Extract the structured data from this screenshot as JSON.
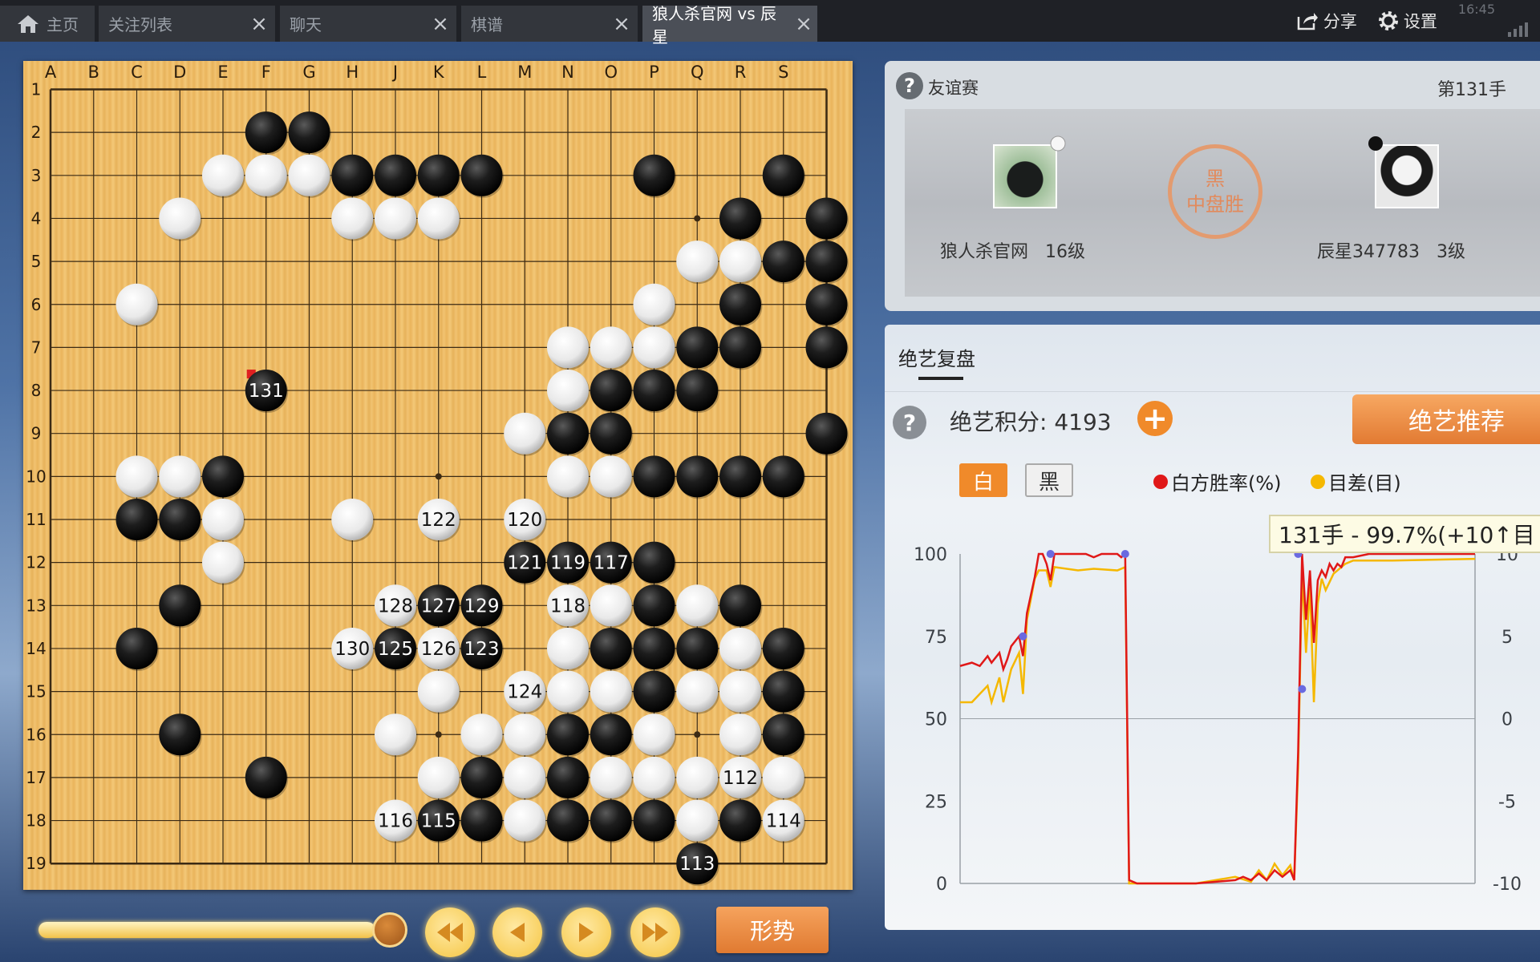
{
  "tabs": [
    {
      "label": "主页",
      "closable": false
    },
    {
      "label": "关注列表",
      "closable": true
    },
    {
      "label": "聊天",
      "closable": true
    },
    {
      "label": "棋谱",
      "closable": true
    },
    {
      "label": "狼人杀官网 vs 辰星",
      "closable": true,
      "active": true
    }
  ],
  "topbar": {
    "share": "分享",
    "settings": "设置",
    "status_time": "16:45"
  },
  "board": {
    "cols": [
      "A",
      "B",
      "C",
      "D",
      "E",
      "F",
      "G",
      "H",
      "J",
      "K",
      "L",
      "M",
      "N",
      "O",
      "P",
      "Q",
      "R",
      "S"
    ],
    "rows": [
      "1",
      "2",
      "3",
      "4",
      "5",
      "6",
      "7",
      "8",
      "9",
      "10",
      "11",
      "12",
      "13",
      "14",
      "15",
      "16",
      "17",
      "18",
      "19"
    ],
    "last_move": "131",
    "stones": [
      {
        "c": "F2",
        "k": "b"
      },
      {
        "c": "G2",
        "k": "b"
      },
      {
        "c": "E3",
        "k": "w"
      },
      {
        "c": "F3",
        "k": "w"
      },
      {
        "c": "G3",
        "k": "w"
      },
      {
        "c": "H3",
        "k": "b"
      },
      {
        "c": "I3",
        "k": "b"
      },
      {
        "c": "J3",
        "k": "b"
      },
      {
        "c": "K3",
        "k": "b"
      },
      {
        "c": "O3",
        "k": "b"
      },
      {
        "c": "R3",
        "k": "b"
      },
      {
        "c": "D4",
        "k": "w"
      },
      {
        "c": "H4",
        "k": "w"
      },
      {
        "c": "I4",
        "k": "w"
      },
      {
        "c": "J4",
        "k": "w"
      },
      {
        "c": "Q4",
        "k": "b"
      },
      {
        "c": "S4",
        "k": "b"
      },
      {
        "c": "P5",
        "k": "w"
      },
      {
        "c": "Q5",
        "k": "w"
      },
      {
        "c": "R5",
        "k": "b"
      },
      {
        "c": "S5",
        "k": "b"
      },
      {
        "c": "C6",
        "k": "w"
      },
      {
        "c": "O6",
        "k": "w"
      },
      {
        "c": "Q6",
        "k": "b"
      },
      {
        "c": "S6",
        "k": "b"
      },
      {
        "c": "M7",
        "k": "w"
      },
      {
        "c": "N7",
        "k": "w"
      },
      {
        "c": "O7",
        "k": "w"
      },
      {
        "c": "P7",
        "k": "b"
      },
      {
        "c": "Q7",
        "k": "b"
      },
      {
        "c": "S7",
        "k": "b"
      },
      {
        "c": "F8",
        "k": "b",
        "n": "131"
      },
      {
        "c": "M8",
        "k": "w"
      },
      {
        "c": "N8",
        "k": "b"
      },
      {
        "c": "O8",
        "k": "b"
      },
      {
        "c": "P8",
        "k": "b"
      },
      {
        "c": "L9",
        "k": "w"
      },
      {
        "c": "M9",
        "k": "b"
      },
      {
        "c": "N9",
        "k": "b"
      },
      {
        "c": "S9",
        "k": "b"
      },
      {
        "c": "C10",
        "k": "w"
      },
      {
        "c": "D10",
        "k": "w"
      },
      {
        "c": "E10",
        "k": "b"
      },
      {
        "c": "M10",
        "k": "w"
      },
      {
        "c": "N10",
        "k": "w"
      },
      {
        "c": "O10",
        "k": "b"
      },
      {
        "c": "P10",
        "k": "b"
      },
      {
        "c": "Q10",
        "k": "b"
      },
      {
        "c": "R10",
        "k": "b"
      },
      {
        "c": "C11",
        "k": "b"
      },
      {
        "c": "D11",
        "k": "b"
      },
      {
        "c": "E11",
        "k": "w"
      },
      {
        "c": "H11",
        "k": "w"
      },
      {
        "c": "J11",
        "k": "w",
        "n": "122"
      },
      {
        "c": "L11",
        "k": "w",
        "n": "120"
      },
      {
        "c": "E12",
        "k": "w"
      },
      {
        "c": "L12",
        "k": "b",
        "n": "121"
      },
      {
        "c": "M12",
        "k": "b",
        "n": "119"
      },
      {
        "c": "N12",
        "k": "b",
        "n": "117"
      },
      {
        "c": "O12",
        "k": "b"
      },
      {
        "c": "D13",
        "k": "b"
      },
      {
        "c": "I13",
        "k": "w",
        "n": "128"
      },
      {
        "c": "J13",
        "k": "b",
        "n": "127"
      },
      {
        "c": "K13",
        "k": "b",
        "n": "129"
      },
      {
        "c": "M13",
        "k": "w",
        "n": "118"
      },
      {
        "c": "N13",
        "k": "w"
      },
      {
        "c": "O13",
        "k": "b"
      },
      {
        "c": "P13",
        "k": "w"
      },
      {
        "c": "Q13",
        "k": "b"
      },
      {
        "c": "C14",
        "k": "b"
      },
      {
        "c": "H14",
        "k": "w",
        "n": "130"
      },
      {
        "c": "I14",
        "k": "b",
        "n": "125"
      },
      {
        "c": "J14",
        "k": "w",
        "n": "126"
      },
      {
        "c": "K14",
        "k": "b",
        "n": "123"
      },
      {
        "c": "M14",
        "k": "w"
      },
      {
        "c": "N14",
        "k": "b"
      },
      {
        "c": "O14",
        "k": "b"
      },
      {
        "c": "P14",
        "k": "b"
      },
      {
        "c": "Q14",
        "k": "w"
      },
      {
        "c": "R14",
        "k": "b"
      },
      {
        "c": "J15",
        "k": "w"
      },
      {
        "c": "L15",
        "k": "w",
        "n": "124"
      },
      {
        "c": "M15",
        "k": "w"
      },
      {
        "c": "N15",
        "k": "w"
      },
      {
        "c": "O15",
        "k": "b"
      },
      {
        "c": "P15",
        "k": "w"
      },
      {
        "c": "Q15",
        "k": "w"
      },
      {
        "c": "R15",
        "k": "b"
      },
      {
        "c": "D16",
        "k": "b"
      },
      {
        "c": "I16",
        "k": "w"
      },
      {
        "c": "K16",
        "k": "w"
      },
      {
        "c": "L16",
        "k": "w"
      },
      {
        "c": "M16",
        "k": "b"
      },
      {
        "c": "N16",
        "k": "b"
      },
      {
        "c": "O16",
        "k": "w"
      },
      {
        "c": "Q16",
        "k": "w"
      },
      {
        "c": "R16",
        "k": "b"
      },
      {
        "c": "F17",
        "k": "b"
      },
      {
        "c": "J17",
        "k": "w"
      },
      {
        "c": "K17",
        "k": "b"
      },
      {
        "c": "L17",
        "k": "w"
      },
      {
        "c": "M17",
        "k": "b"
      },
      {
        "c": "N17",
        "k": "w"
      },
      {
        "c": "O17",
        "k": "w"
      },
      {
        "c": "P17",
        "k": "w"
      },
      {
        "c": "Q17",
        "k": "w",
        "n": "112"
      },
      {
        "c": "R17",
        "k": "w"
      },
      {
        "c": "I18",
        "k": "w",
        "n": "116"
      },
      {
        "c": "J18",
        "k": "b",
        "n": "115"
      },
      {
        "c": "K18",
        "k": "b"
      },
      {
        "c": "L18",
        "k": "w"
      },
      {
        "c": "M18",
        "k": "b"
      },
      {
        "c": "N18",
        "k": "b"
      },
      {
        "c": "O18",
        "k": "b"
      },
      {
        "c": "P18",
        "k": "w"
      },
      {
        "c": "Q18",
        "k": "b"
      },
      {
        "c": "R18",
        "k": "w",
        "n": "114"
      },
      {
        "c": "P19",
        "k": "b",
        "n": "113"
      }
    ]
  },
  "controls": {
    "progress": 0.9,
    "situation_button": "形势"
  },
  "game_info": {
    "game_type": "友谊赛",
    "move_number": "第131手",
    "result_line1": "黑",
    "result_line2": "中盘胜",
    "white_player": {
      "name": "狼人杀官网",
      "rank": "16级"
    },
    "black_player": {
      "name": "辰星347783",
      "rank": "3级"
    }
  },
  "analysis": {
    "tab_label": "绝艺复盘",
    "score_label": "绝艺积分: 4193",
    "recommend_button": "绝艺推荐",
    "toggle_white": "白",
    "toggle_black": "黑",
    "legend_winrate": "白方胜率(%)",
    "legend_diff": "目差(目)",
    "tooltip": "131手 - 99.7%(+10↑目",
    "colors": {
      "winrate": "#e01818",
      "diff": "#f5b800",
      "accent": "#f08a2a"
    }
  },
  "chart_data": {
    "type": "line",
    "x_range": [
      0,
      131
    ],
    "y_left_ticks": [
      "100",
      "75",
      "50",
      "25",
      "0"
    ],
    "y_left_range": [
      0,
      100
    ],
    "y_right_ticks": [
      "10",
      "5",
      "0",
      "-5",
      "-10"
    ],
    "y_right_range": [
      -10,
      10
    ],
    "series": [
      {
        "name": "白方胜率(%)",
        "points": [
          [
            0,
            66
          ],
          [
            3,
            67
          ],
          [
            5,
            66
          ],
          [
            7,
            69
          ],
          [
            8,
            67
          ],
          [
            10,
            70
          ],
          [
            11,
            65
          ],
          [
            12,
            68
          ],
          [
            13,
            72
          ],
          [
            15,
            75
          ],
          [
            16,
            69
          ],
          [
            17,
            82
          ],
          [
            19,
            93
          ],
          [
            20,
            100
          ],
          [
            21,
            100
          ],
          [
            22,
            97
          ],
          [
            23,
            92
          ],
          [
            24,
            100
          ],
          [
            26,
            100
          ],
          [
            28,
            101
          ],
          [
            30,
            100
          ],
          [
            32,
            101
          ],
          [
            34,
            99
          ],
          [
            36,
            101
          ],
          [
            38,
            100
          ],
          [
            40,
            101
          ],
          [
            41,
            99
          ],
          [
            42,
            101
          ],
          [
            43,
            1
          ],
          [
            45,
            0
          ],
          [
            50,
            0
          ],
          [
            60,
            0
          ],
          [
            70,
            1
          ],
          [
            72,
            2
          ],
          [
            74,
            1
          ],
          [
            76,
            3
          ],
          [
            78,
            1
          ],
          [
            80,
            4
          ],
          [
            82,
            2
          ],
          [
            84,
            4
          ],
          [
            85,
            1
          ],
          [
            86,
            40
          ],
          [
            87,
            100
          ],
          [
            88,
            80
          ],
          [
            89,
            95
          ],
          [
            90,
            73
          ],
          [
            91,
            92
          ],
          [
            92,
            95
          ],
          [
            93,
            93
          ],
          [
            94,
            97
          ],
          [
            95,
            95
          ],
          [
            96,
            97
          ],
          [
            97,
            96
          ],
          [
            98,
            99
          ],
          [
            100,
            99
          ],
          [
            104,
            100
          ],
          [
            110,
            100
          ],
          [
            115,
            100
          ],
          [
            120,
            100
          ],
          [
            125,
            100
          ],
          [
            131,
            100
          ]
        ]
      },
      {
        "name": "目差(目)",
        "points": [
          [
            0,
            1
          ],
          [
            3,
            1
          ],
          [
            5,
            1.5
          ],
          [
            7,
            2
          ],
          [
            8,
            1
          ],
          [
            10,
            2.5
          ],
          [
            11,
            1
          ],
          [
            12,
            2
          ],
          [
            13,
            3
          ],
          [
            15,
            4
          ],
          [
            16,
            1.5
          ],
          [
            17,
            6
          ],
          [
            19,
            8.5
          ],
          [
            20,
            9
          ],
          [
            22,
            9
          ],
          [
            23,
            8
          ],
          [
            24,
            9.2
          ],
          [
            30,
            9
          ],
          [
            34,
            9.1
          ],
          [
            40,
            9
          ],
          [
            42,
            9.2
          ],
          [
            43,
            -10
          ],
          [
            60,
            -10
          ],
          [
            70,
            -9.6
          ],
          [
            74,
            -9.9
          ],
          [
            76,
            -9.2
          ],
          [
            78,
            -9.8
          ],
          [
            80,
            -8.8
          ],
          [
            82,
            -9.5
          ],
          [
            84,
            -8.9
          ],
          [
            85,
            -9.8
          ],
          [
            86,
            -3
          ],
          [
            87,
            9
          ],
          [
            88,
            4
          ],
          [
            89,
            8
          ],
          [
            90,
            1
          ],
          [
            91,
            7
          ],
          [
            92,
            8.5
          ],
          [
            93,
            7.8
          ],
          [
            95,
            8.8
          ],
          [
            98,
            9.4
          ],
          [
            100,
            9.6
          ],
          [
            110,
            9.6
          ],
          [
            131,
            9.7
          ]
        ]
      }
    ],
    "markers": [
      [
        16,
        75
      ],
      [
        23,
        100
      ],
      [
        42,
        100
      ],
      [
        86,
        100
      ],
      [
        87,
        59
      ]
    ]
  }
}
